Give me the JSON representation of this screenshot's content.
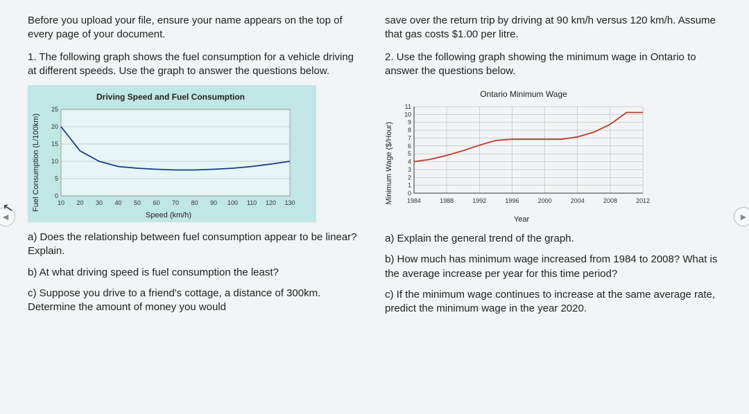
{
  "intro": "Before you upload your file, ensure your name appears on the top of every page of your document.",
  "q1": {
    "num": "1.",
    "text": "The following graph shows the fuel consumption for a vehicle driving at different speeds. Use the graph to answer the questions below.",
    "a": "a) Does the relationship between fuel consumption appear to be linear? Explain.",
    "b": "b) At what driving speed is fuel consumption the least?",
    "c": "c) Suppose you drive to a friend's cottage, a distance of 300km. Determine the amount of money you would"
  },
  "q1_cont": "save over the return trip by driving at 90 km/h versus 120 km/h. Assume that gas costs $1.00 per litre.",
  "q2": {
    "num": "2.",
    "text": "Use the following graph showing the minimum wage in Ontario to answer the questions below.",
    "a": "a) Explain the general trend of the graph.",
    "b": "b) How much has minimum wage increased from 1984 to 2008? What is the average increase per year for this time period?",
    "c": "c) If the minimum wage continues to increase at the same average rate, predict the minimum wage in the year 2020."
  },
  "chart_data": [
    {
      "type": "line",
      "title": "Driving Speed and Fuel Consumption",
      "xlabel": "Speed (km/h)",
      "ylabel": "Fuel Consumption (L/100km)",
      "xlim": [
        10,
        130
      ],
      "ylim": [
        0,
        25
      ],
      "xticks": [
        10,
        20,
        30,
        40,
        50,
        60,
        70,
        80,
        90,
        100,
        110,
        120,
        130
      ],
      "yticks": [
        0,
        5,
        10,
        15,
        20,
        25
      ],
      "x": [
        10,
        20,
        30,
        40,
        50,
        60,
        70,
        80,
        90,
        100,
        110,
        120,
        130
      ],
      "y": [
        20,
        13,
        10,
        8.5,
        8,
        7.7,
        7.5,
        7.5,
        7.7,
        8,
        8.5,
        9.2,
        10
      ]
    },
    {
      "type": "line",
      "title": "Ontario Minimum Wage",
      "xlabel": "Year",
      "ylabel": "Minimum Wage ($/Hour)",
      "xlim": [
        1984,
        2012
      ],
      "ylim": [
        0,
        11
      ],
      "xticks": [
        1984,
        1988,
        1992,
        1996,
        2000,
        2004,
        2008,
        2012
      ],
      "yticks": [
        0,
        1,
        2,
        3,
        4,
        5,
        6,
        7,
        8,
        9,
        10,
        11
      ],
      "x": [
        1984,
        1986,
        1988,
        1990,
        1992,
        1994,
        1996,
        1998,
        2000,
        2002,
        2004,
        2006,
        2008,
        2010,
        2012
      ],
      "y": [
        4.0,
        4.3,
        4.8,
        5.4,
        6.1,
        6.7,
        6.85,
        6.85,
        6.85,
        6.85,
        7.15,
        7.75,
        8.75,
        10.25,
        10.25
      ]
    }
  ]
}
